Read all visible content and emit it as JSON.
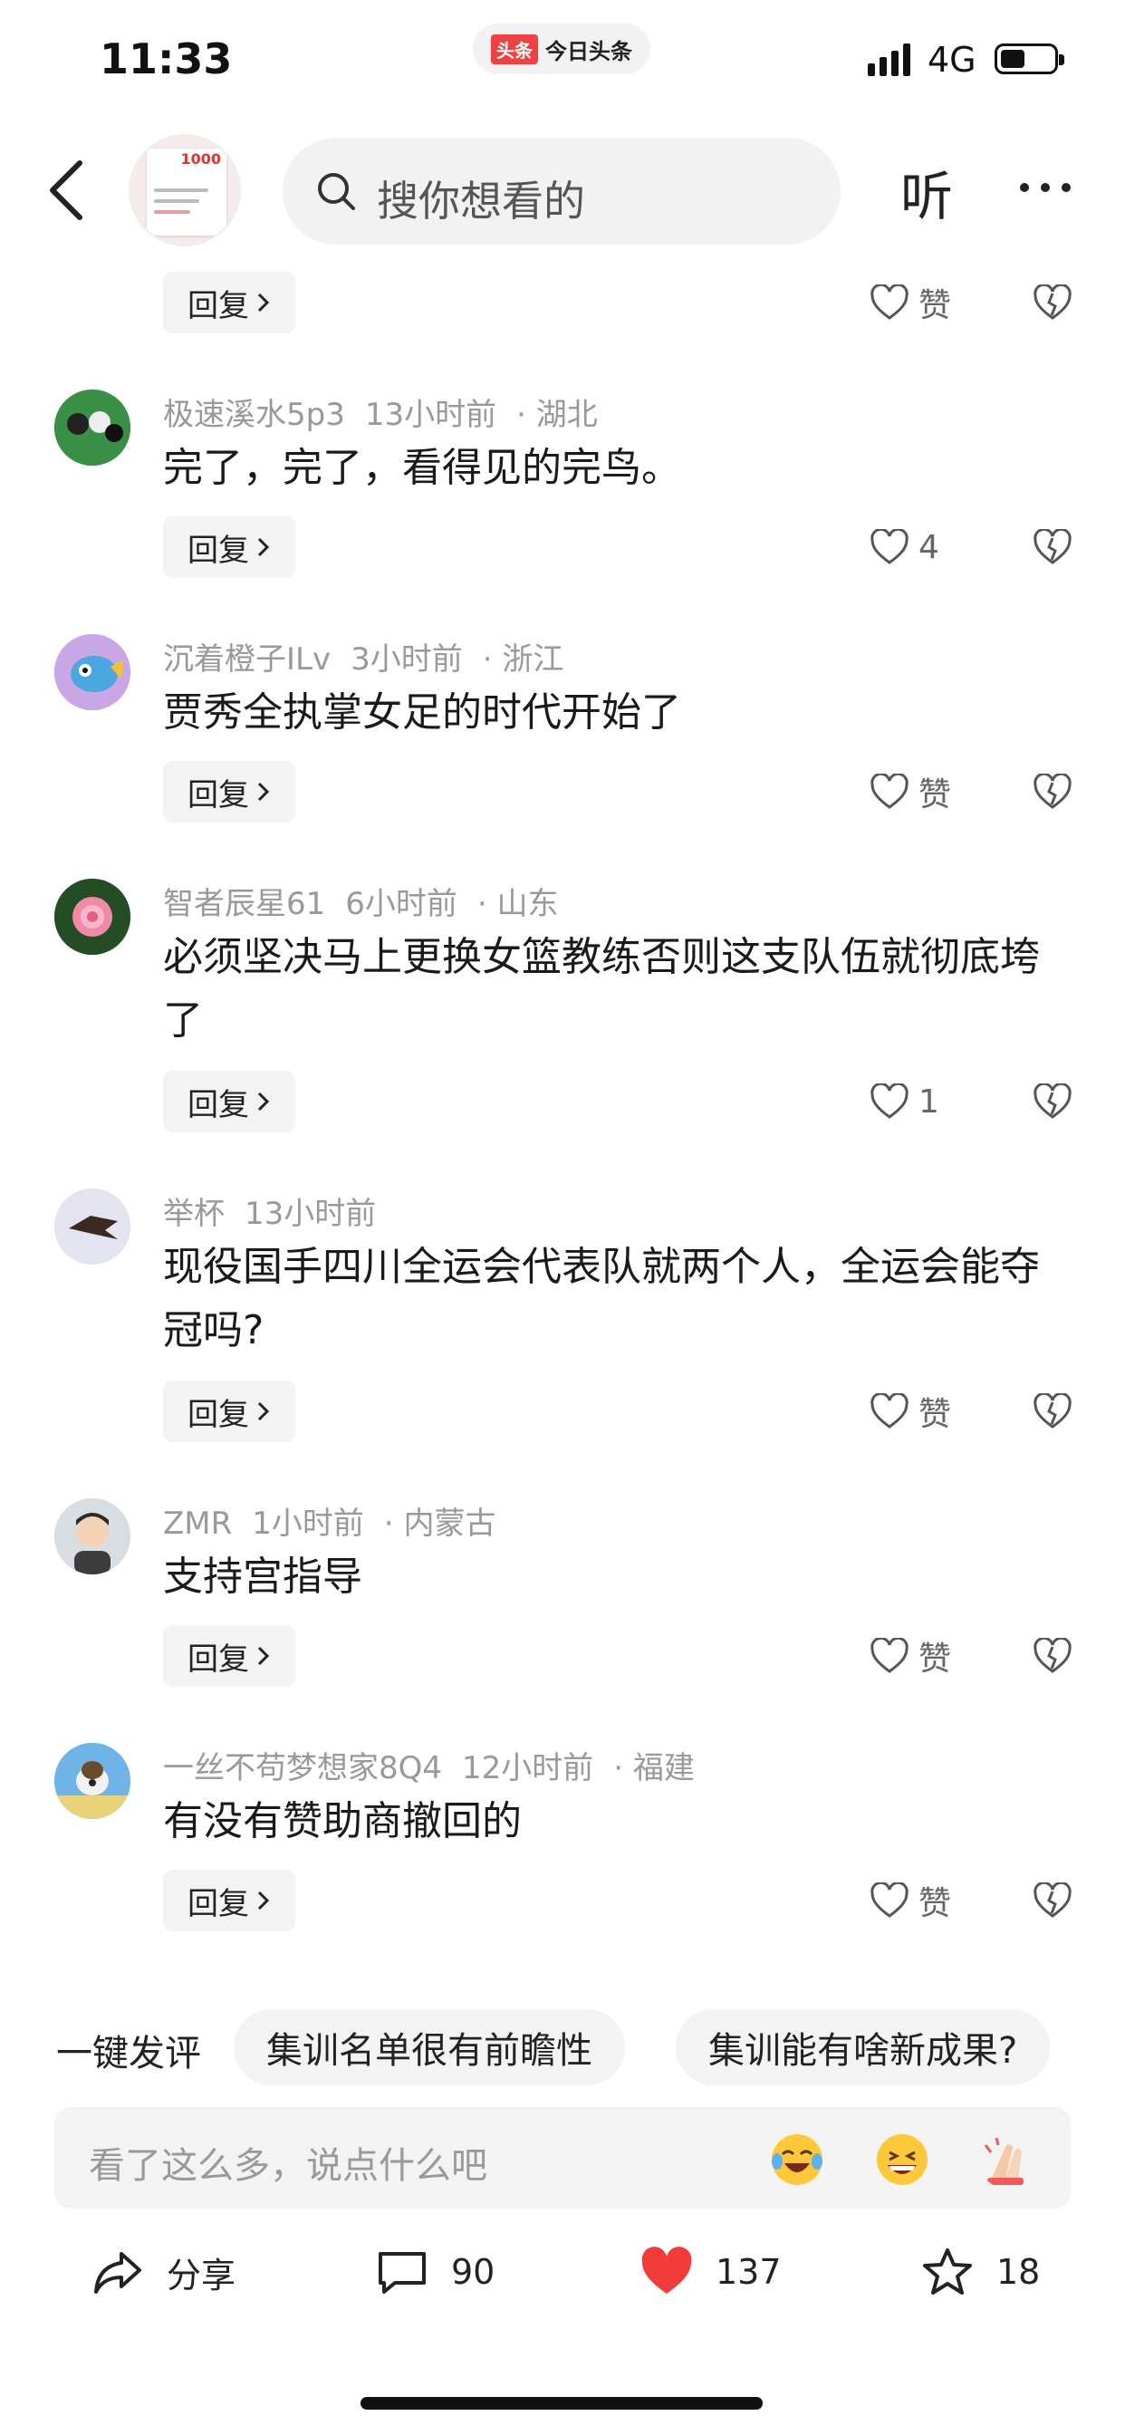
{
  "status_bar": {
    "time": "11:33",
    "app_badge": "头条",
    "app_name": "今日头条",
    "network": "4G"
  },
  "header": {
    "thumb_number": "1000",
    "search_placeholder": "搜你想看的",
    "listen_label": "听"
  },
  "comments": [
    {
      "user": "",
      "time": "",
      "location": "",
      "text": "",
      "reply_label": "回复",
      "like_label": "赞"
    },
    {
      "user": "极速溪水5p3",
      "time": "13小时前",
      "location": "· 湖北",
      "text": "完了，完了，看得见的完鸟。",
      "reply_label": "回复",
      "like_label": "4"
    },
    {
      "user": "沉着橙子ILv",
      "time": "3小时前",
      "location": "· 浙江",
      "text": "贾秀全执掌女足的时代开始了",
      "reply_label": "回复",
      "like_label": "赞"
    },
    {
      "user": "智者辰星61",
      "time": "6小时前",
      "location": "· 山东",
      "text": "必须坚决马上更换女篮教练否则这支队伍就彻底垮了",
      "reply_label": "回复",
      "like_label": "1"
    },
    {
      "user": "举杯",
      "time": "13小时前",
      "location": "",
      "text": "现役国手四川全运会代表队就两个人，全运会能夺冠吗?",
      "reply_label": "回复",
      "like_label": "赞"
    },
    {
      "user": "ZMR",
      "time": "1小时前",
      "location": "· 内蒙古",
      "text": "支持宫指导",
      "reply_label": "回复",
      "like_label": "赞"
    },
    {
      "user": "一丝不苟梦想家8Q4",
      "time": "12小时前",
      "location": "· 福建",
      "text": "有没有赞助商撤回的",
      "reply_label": "回复",
      "like_label": "赞"
    }
  ],
  "suggestions": {
    "label": "一键发评",
    "chips": [
      "集训名单很有前瞻性",
      "集训能有啥新成果?"
    ]
  },
  "comment_input": {
    "placeholder": "看了这么多，说点什么吧"
  },
  "bottom_bar": {
    "share": "分享",
    "comments": "90",
    "likes": "137",
    "favorites": "18"
  },
  "colors": {
    "brand_red": "#f04142",
    "like_red": "#f23c3c",
    "muted_text": "#999999",
    "chip_bg": "#f3f3f3"
  },
  "icons": [
    "back-icon",
    "search-icon",
    "more-icon",
    "heart-icon",
    "broken-heart-icon",
    "share-icon",
    "comment-icon",
    "star-icon",
    "chevron-right-icon"
  ]
}
